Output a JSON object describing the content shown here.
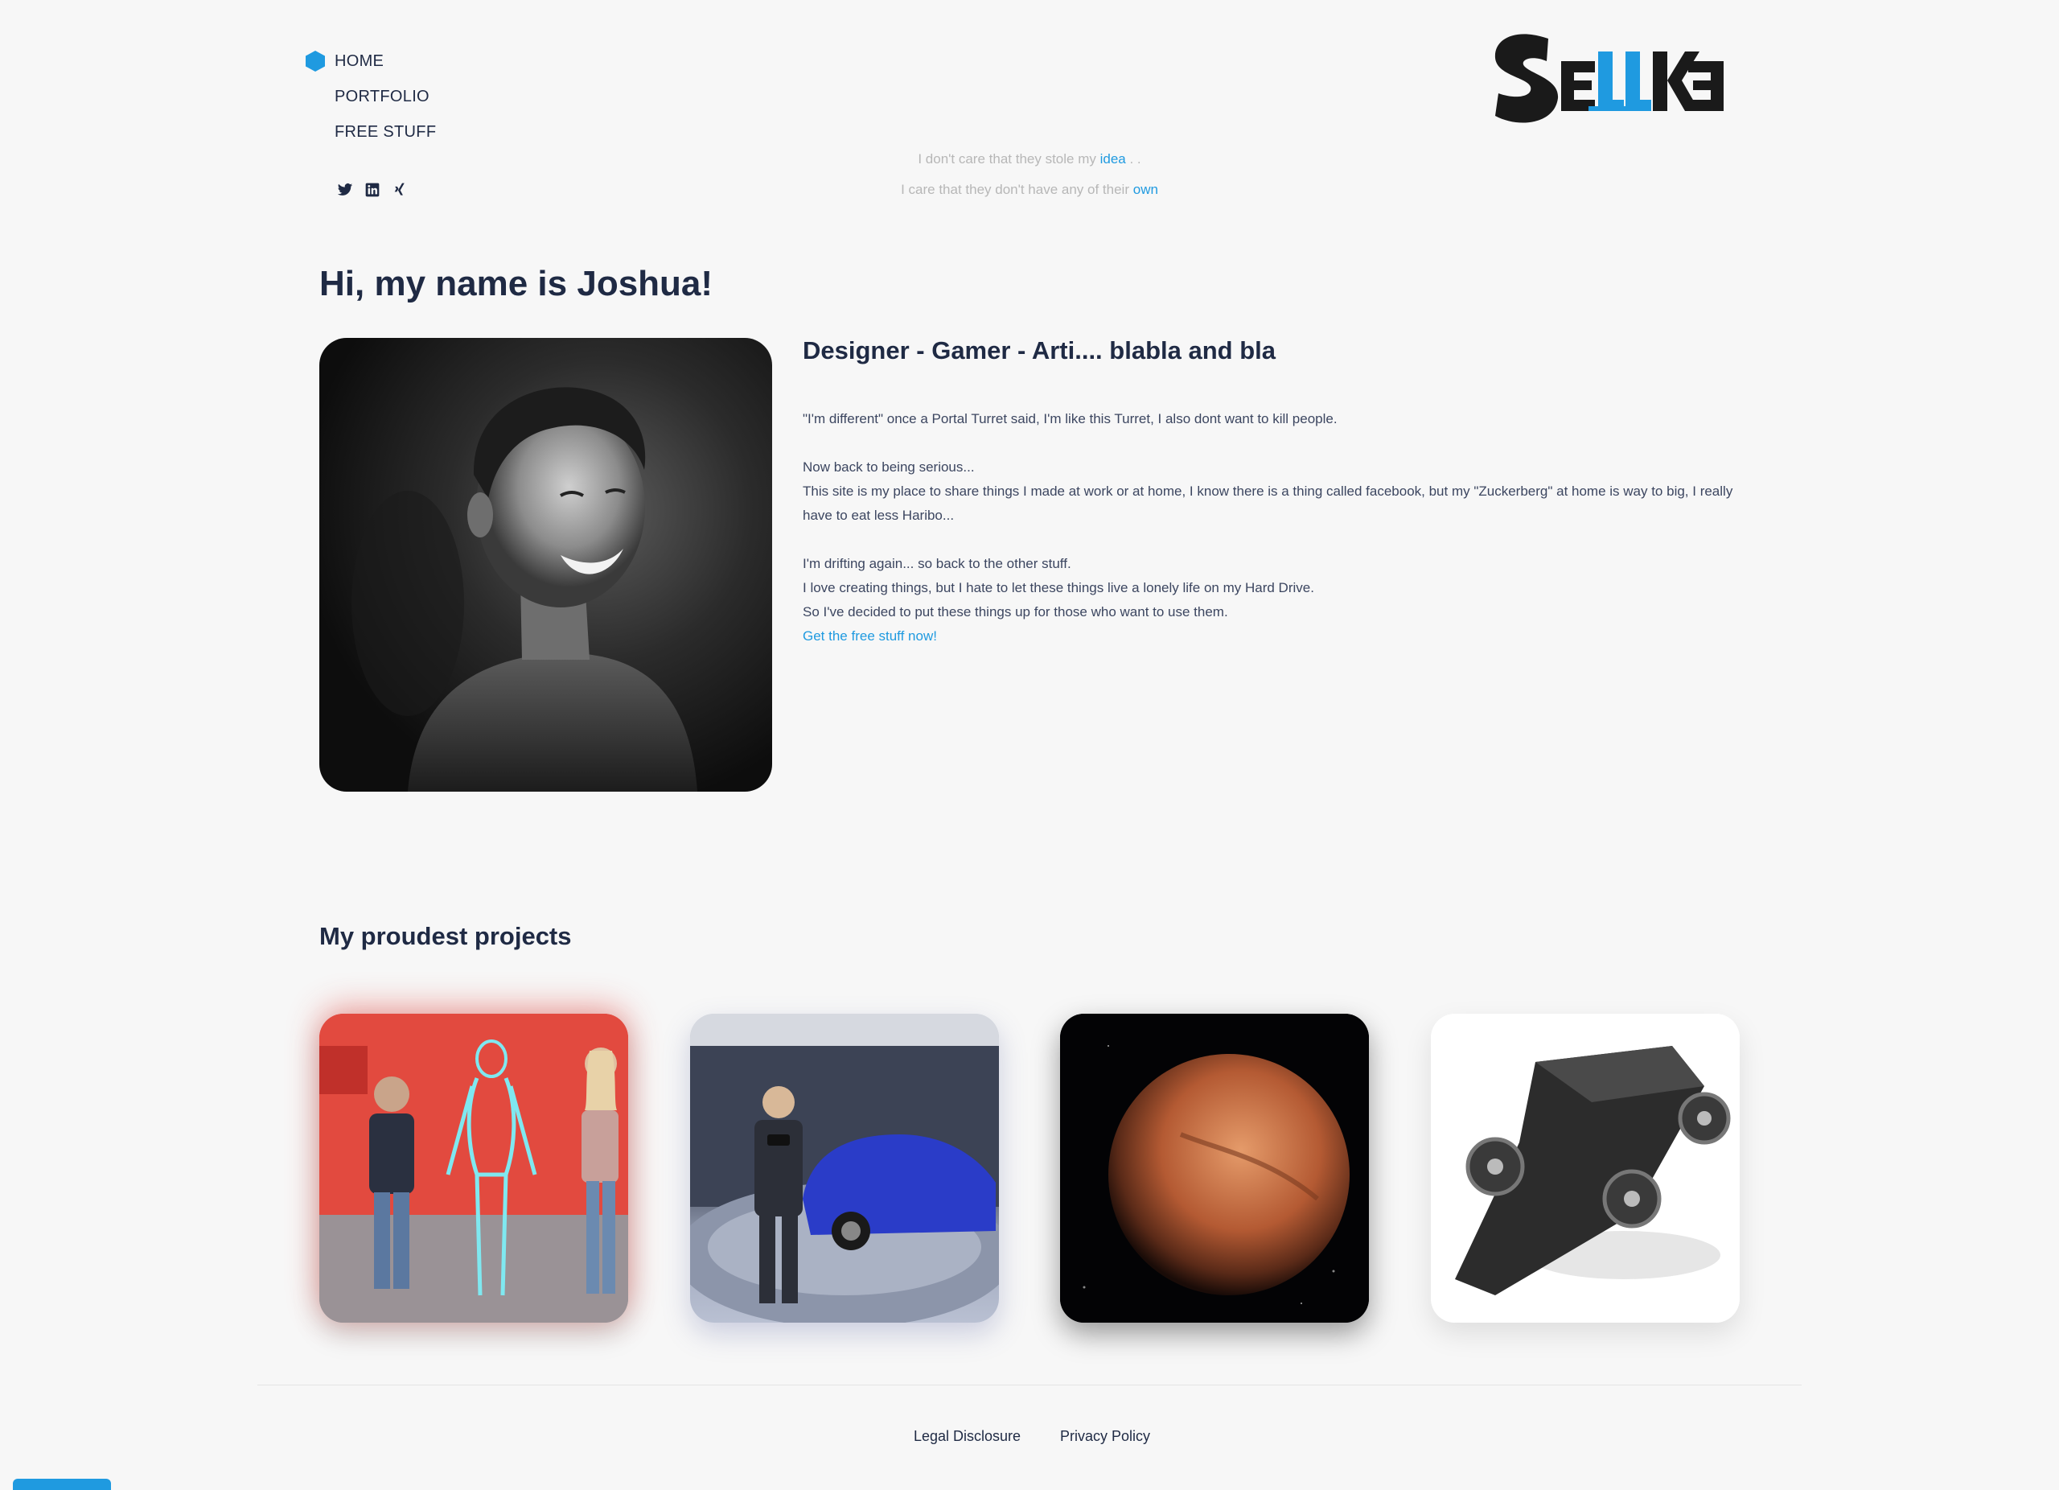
{
  "nav": {
    "items": [
      {
        "label": "HOME",
        "active": true
      },
      {
        "label": "PORTFOLIO",
        "active": false
      },
      {
        "label": "FREE STUFF",
        "active": false
      }
    ],
    "social_icons": [
      "twitter-icon",
      "linkedin-icon",
      "xing-icon"
    ]
  },
  "logo": {
    "colors": {
      "dark": "#1a1a1a",
      "accent": "#1f9ae0"
    }
  },
  "quote": {
    "line1_prefix": "I don't care that they stole my ",
    "line1_accent": "idea",
    "line1_suffix": " . .",
    "line2_prefix": "I care that they don't have any of their ",
    "line2_accent": "own"
  },
  "hero": {
    "title": "Hi, my name is Joshua!",
    "subtitle": "Designer - Gamer - Arti.... blabla and bla",
    "bio": {
      "p1": "\"I'm different\" once a Portal Turret said, I'm like this Turret, I also dont want to kill people.",
      "p2_line1": "Now back to being serious...",
      "p2_line2": "This site is my place to share things I made at work or at home, I know there is a thing called facebook, but my \"Zuckerberg\" at home is way to big, I really have to eat less Haribo...",
      "p3_line1": "I'm drifting again... so back to the other stuff.",
      "p3_line2": "I love creating things, but I hate to let these things live a lonely life on my Hard Drive.",
      "p3_line3": "So I've decided to put these things up for those who want to use them.",
      "cta": "Get the free stuff now!"
    }
  },
  "projects": {
    "title": "My proudest projects"
  },
  "footer": {
    "legal": "Legal Disclosure",
    "privacy": "Privacy Policy"
  },
  "colors": {
    "accent": "#1f9ae0",
    "text": "#1f2a44",
    "background": "#f7f7f7"
  }
}
